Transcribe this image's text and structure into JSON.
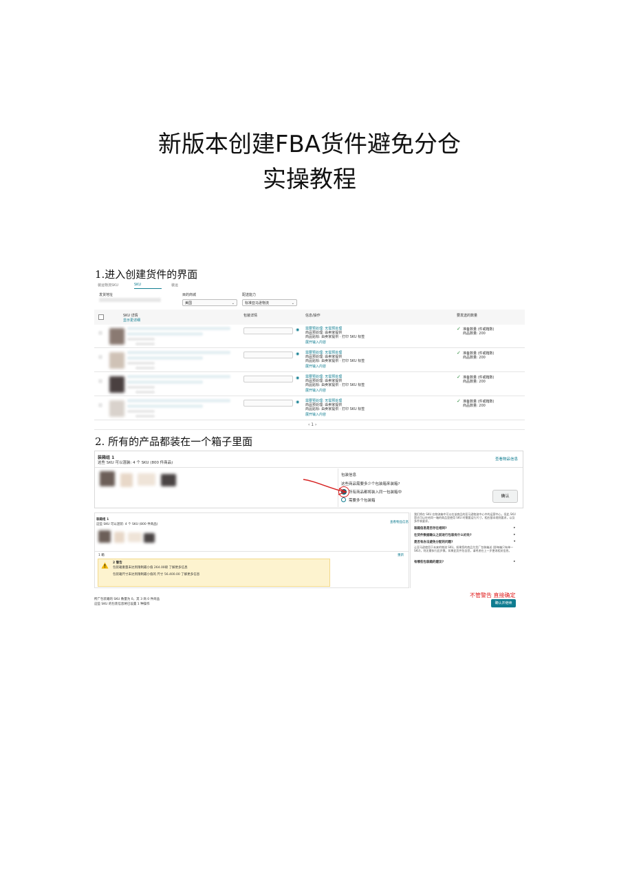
{
  "doc": {
    "title_line1": "新版本创建FBA货件避免分仓",
    "title_line2": "实操教程",
    "step1": "1.进入创建货件的界面",
    "step2": "2.  所有的产品都装在一个箱子里面"
  },
  "shot1": {
    "tabs": [
      "装运物流SKU",
      "SKU",
      "装运"
    ],
    "origin_label": "发货地址",
    "marketplace_label": "目的商城",
    "marketplace_value": "美国",
    "fulfillment_label": "配送能力",
    "fulfillment_value": "标准亚马逊物流",
    "col_sku": "SKU 详情",
    "col_sku_sub": "显示更详细",
    "col_packing": "包装详情",
    "col_prep": "信息/操作",
    "col_qty": "要发送的数量",
    "rows": [
      {
        "prep1": "需要预处理: 无需预处理",
        "prep2": "商品预处理: 由卖家提供",
        "prep3": "商品贴标: 由卖家提供 · 打印 SKU 标签",
        "expand": "展开输入内容",
        "qty1": "准备数量 (件或箱数)",
        "qty2": "商品数量: 200"
      },
      {
        "prep1": "需要预处理: 无需预处理",
        "prep2": "商品预处理: 由卖家提供",
        "prep3": "商品贴标: 由卖家提供 · 打印 SKU 标签",
        "expand": "展开输入内容",
        "qty1": "准备数量 (件或箱数)",
        "qty2": "商品数量: 200"
      },
      {
        "prep1": "需要预处理: 无需预处理",
        "prep2": "商品预处理: 由卖家提供",
        "prep3": "商品贴标: 由卖家提供 · 打印 SKU 标签",
        "expand": "展开输入内容",
        "qty1": "准备数量 (件或箱数)",
        "qty2": "商品数量: 200"
      },
      {
        "prep1": "需要预处理: 无需预处理",
        "prep2": "商品预处理: 由卖家提供",
        "prep3": "商品贴标: 由卖家提供 · 打印 SKU 标签",
        "expand": "展开输入内容",
        "qty1": "准备数量 (件或箱数)",
        "qty2": "商品数量: 200"
      }
    ],
    "pagination": "‹  1  ›"
  },
  "shot2": {
    "group_title": "装箱组 1",
    "group_sub": "这些 SKU 可以混装: 4 个 SKU (800 件商品)",
    "view_info": "查看物品信息",
    "pack_header": "包装信息",
    "pack_question": "这些商品需要多少个包装箱来装箱?",
    "option1": "所有商品都将装入同一包装箱中",
    "option2": "需要多个包装箱",
    "confirm": "确认",
    "group2_title": "装箱组 1",
    "group2_sub": "这些 SKU 可以混装: 4 个 SKU (800 件商品)",
    "group2_link": "查看物品信息",
    "box_count": "1 箱",
    "edit": "重新",
    "warn_title": "2 警告",
    "warn1": "包装箱重量未达到限制最小值 264.00磅 了解更多信息",
    "warn2": "包装箱尺寸未达到限制最小值的 尺寸 56.400.00 了解更多信息",
    "faq_intro": "我们将在 SKU 在物流箱中可以在该商品的亚马逊物流中心中的运营中心，但此 SKU 是还可以在给同一箱的商品里使用 SKU 时需要运行尺寸，相应基本规则要求，以及多件装要求。",
    "faq": [
      "装箱信息是否存在相同?",
      "在货件数据确认之前进行包装有什么好处?",
      "是否有办法避免分配的问题?",
      "有哪些包装箱的建议?"
    ],
    "faq_body": "让亚马逊使用于未来的物流 SKU。如果您的商品为货厂包装箱送 (即每箱只有单一 SKU)，则无需执行此步骤。如果此货件包含您，请考虑在上一步更改相关信息。",
    "footer1": "所广包装箱的 SKU 数量为 0，其 3 商 0 件商品",
    "footer2": "这些 SKU 的包装信息将已设置 1 种操作",
    "annotation": "不管警告 直接确定",
    "primary_btn": "确认并继续"
  }
}
